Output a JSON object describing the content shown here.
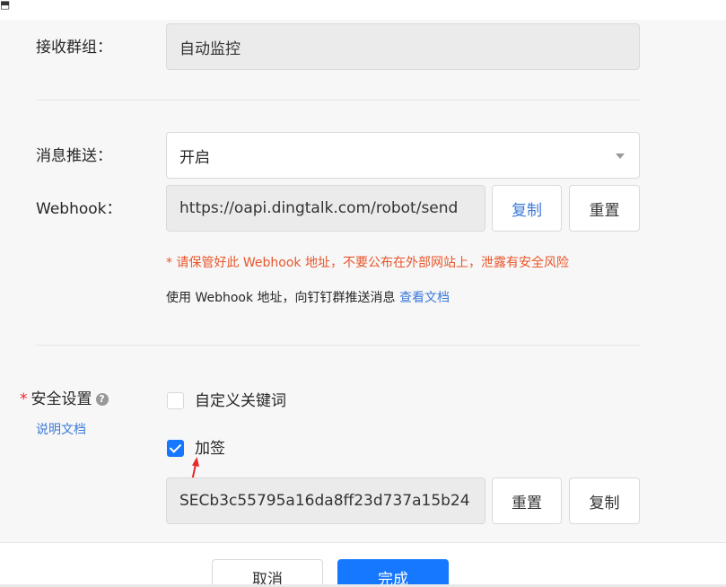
{
  "form": {
    "receive_group": {
      "label": "接收群组：",
      "value": "自动监控"
    },
    "message_push": {
      "label": "消息推送：",
      "value": "开启"
    },
    "webhook": {
      "label": "Webhook：",
      "value": "https://oapi.dingtalk.com/robot/send",
      "copy_label": "复制",
      "reset_label": "重置",
      "warning": "* 请保管好此 Webhook 地址，不要公布在外部网站上，泄露有安全风险",
      "usage_text": "使用 Webhook 地址，向钉钉群推送消息",
      "docs_link": "查看文档"
    },
    "security": {
      "required_mark": "*",
      "label": "安全设置",
      "help_icon": "question-circle-icon",
      "docs_link": "说明文档",
      "custom_keyword": {
        "label": "自定义关键词",
        "checked": false
      },
      "signature": {
        "label": "加签",
        "checked": true
      },
      "secret_value": "SECb3c55795a16da8ff23d737a15b24",
      "reset_label": "重置",
      "copy_label": "复制"
    }
  },
  "footer": {
    "cancel_label": "取消",
    "confirm_label": "完成"
  },
  "annotation": {
    "arrow_color": "#e8282b"
  },
  "colors": {
    "primary": "#1677ff",
    "link": "#3b7ad9",
    "warning": "#e8562b"
  }
}
